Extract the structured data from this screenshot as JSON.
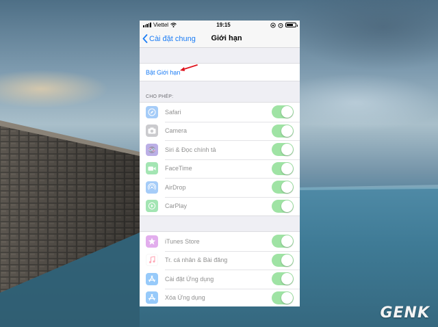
{
  "status_bar": {
    "carrier": "Viettel",
    "time": "19:15",
    "battery_level": 0.75
  },
  "nav": {
    "back_label": "Cài đặt chung",
    "title": "Giới hạn"
  },
  "enable_restrictions": {
    "label": "Bật Giới hạn"
  },
  "allow_section": {
    "header": "CHO PHÉP:",
    "items": [
      {
        "label": "Safari",
        "icon": "safari-icon",
        "color": "#3a8ff0",
        "toggle_on": true
      },
      {
        "label": "Camera",
        "icon": "camera-icon",
        "color": "#8e8e93",
        "toggle_on": true
      },
      {
        "label": "Siri & Đọc chính tả",
        "icon": "siri-icon",
        "color": "#6b4fc8",
        "toggle_on": true
      },
      {
        "label": "FaceTime",
        "icon": "facetime-icon",
        "color": "#34c759",
        "toggle_on": true
      },
      {
        "label": "AirDrop",
        "icon": "airdrop-icon",
        "color": "#3a8ff0",
        "toggle_on": true
      },
      {
        "label": "CarPlay",
        "icon": "carplay-icon",
        "color": "#34c759",
        "toggle_on": true
      }
    ]
  },
  "store_section": {
    "items": [
      {
        "label": "iTunes Store",
        "icon": "itunes-store-icon",
        "color": "#c04bd8",
        "toggle_on": true
      },
      {
        "label": "Tr. cá nhân & Bài đăng",
        "icon": "music-note-icon",
        "color": "#ff3b5c",
        "toggle_on": true
      },
      {
        "label": "Cài đặt Ứng dụng",
        "icon": "app-store-icon",
        "color": "#1a8cf5",
        "toggle_on": true
      },
      {
        "label": "Xóa Ứng dụng",
        "icon": "app-store-delete-icon",
        "color": "#1a8cf5",
        "toggle_on": true
      }
    ]
  },
  "watermark": {
    "text": "GENK"
  },
  "colors": {
    "ios_blue": "#1a7cf5",
    "toggle_green": "#4cd964",
    "arrow_red": "#e0141e"
  }
}
